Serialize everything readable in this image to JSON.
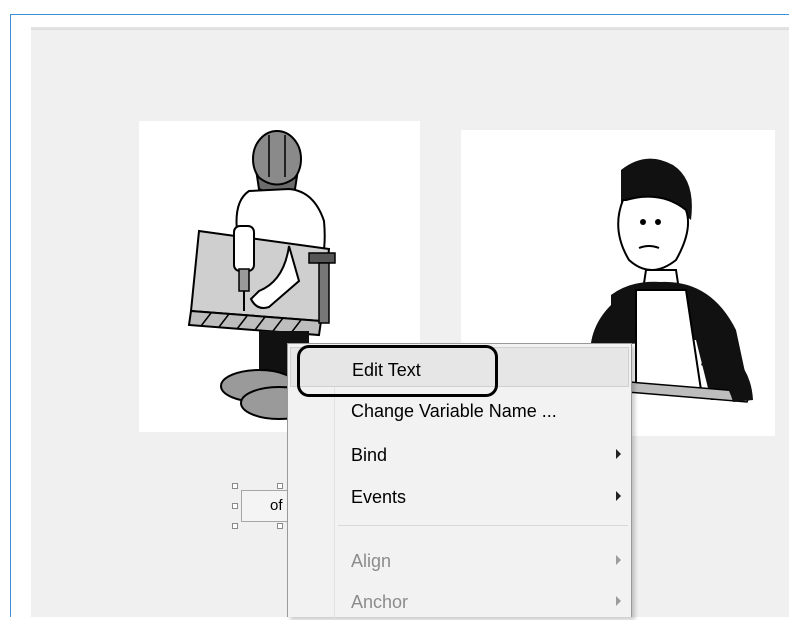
{
  "designer": {
    "images": [
      {
        "name": "worker-drilling"
      },
      {
        "name": "clerk-at-counter"
      }
    ],
    "selected_control": {
      "text": "of"
    }
  },
  "context_menu": {
    "items": [
      {
        "label": "Edit Text",
        "enabled": true,
        "submenu": false,
        "hovered": true
      },
      {
        "label": "Change Variable Name ...",
        "enabled": true,
        "submenu": false
      },
      {
        "label": "Bind",
        "enabled": true,
        "submenu": true
      },
      {
        "label": "Events",
        "enabled": true,
        "submenu": true
      },
      {
        "label": "Align",
        "enabled": false,
        "submenu": true
      },
      {
        "label": "Anchor",
        "enabled": false,
        "submenu": true
      }
    ]
  },
  "colors": {
    "window_border": "#3f8fd8",
    "canvas_bg": "#f0f0f0",
    "menu_bg": "#f2f2f2",
    "disabled_text": "#8c8c8c"
  }
}
